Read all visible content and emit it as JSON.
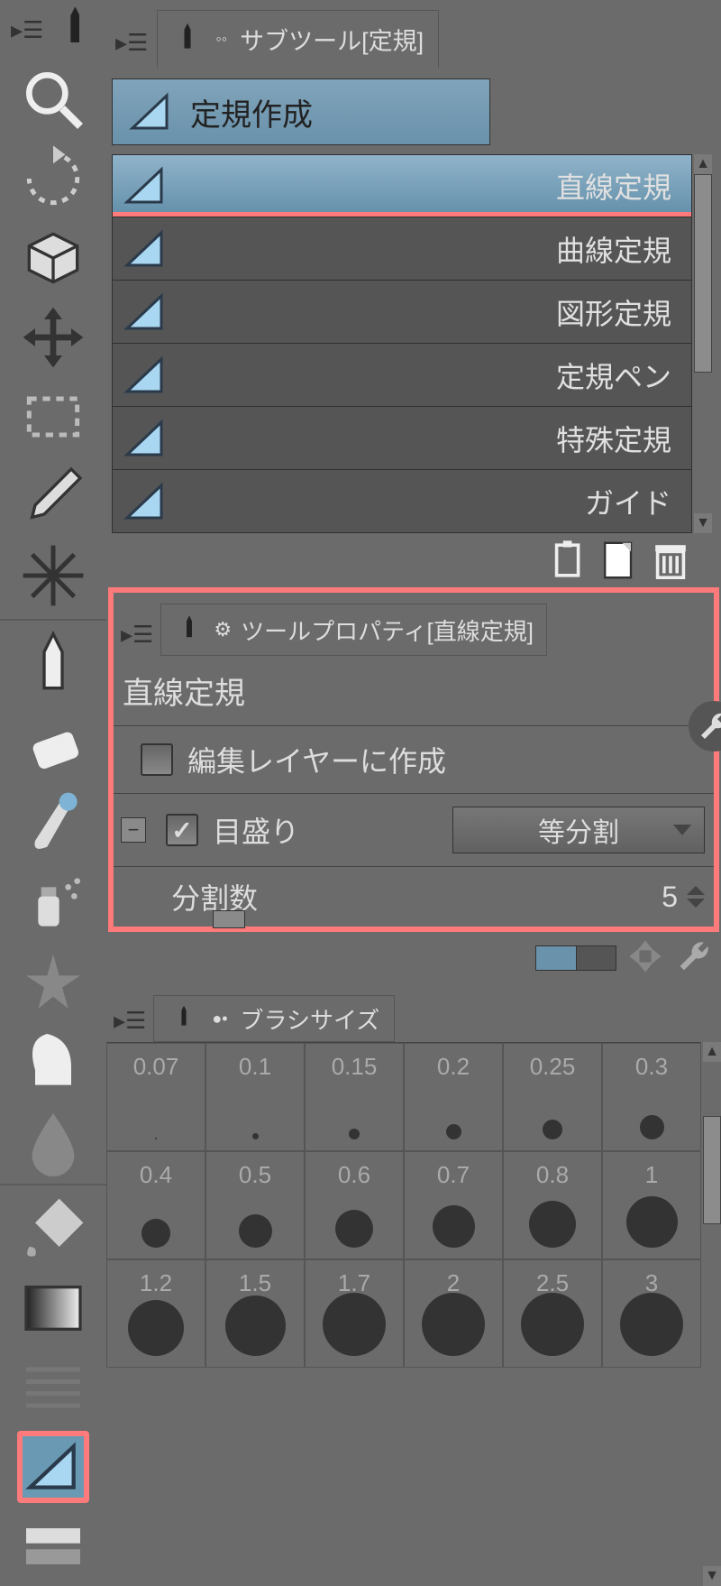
{
  "subtool_panel": {
    "title": "サブツール[定規]",
    "category": "定規作成",
    "items": [
      {
        "label": "直線定規",
        "selected": true
      },
      {
        "label": "曲線定規"
      },
      {
        "label": "図形定規"
      },
      {
        "label": "定規ペン"
      },
      {
        "label": "特殊定規"
      },
      {
        "label": "ガイド"
      }
    ]
  },
  "property_panel": {
    "title": "ツールプロパティ[直線定規]",
    "tool_name": "直線定規",
    "options": {
      "create_on_edit_layer": {
        "label": "編集レイヤーに作成",
        "checked": false
      },
      "scale": {
        "label": "目盛り",
        "checked": true,
        "select_value": "等分割"
      },
      "divisions": {
        "label": "分割数",
        "value": 5
      }
    }
  },
  "brush_panel": {
    "title": "ブラシサイズ",
    "sizes": [
      0.07,
      0.1,
      0.15,
      0.2,
      0.25,
      0.3,
      0.4,
      0.5,
      0.6,
      0.7,
      0.8,
      1.0,
      1.2,
      1.5,
      1.7,
      2,
      2.5,
      3
    ]
  }
}
